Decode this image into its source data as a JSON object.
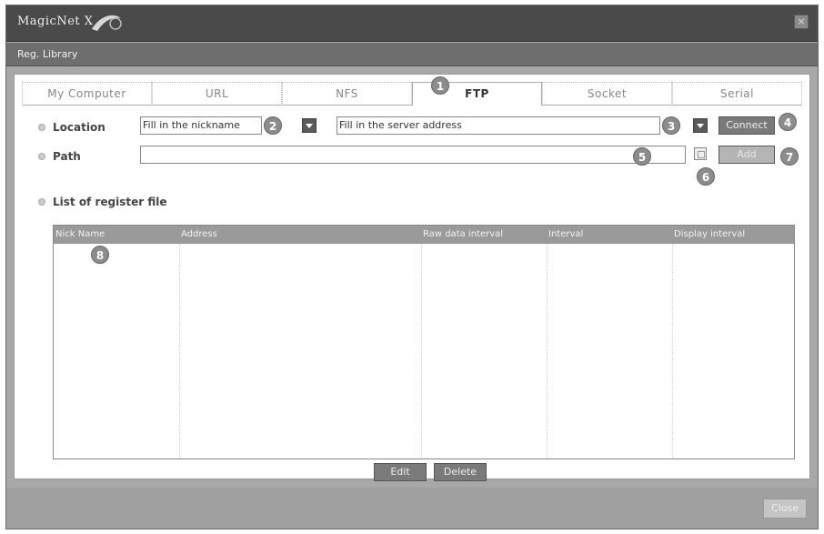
{
  "window": {
    "app_name": "MagicNet X",
    "close_glyph": "×"
  },
  "menubar": {
    "label": "Reg. Library"
  },
  "tabs": [
    {
      "label": "My Computer"
    },
    {
      "label": "URL"
    },
    {
      "label": "NFS"
    },
    {
      "label": "FTP",
      "active": true
    },
    {
      "label": "Socket"
    },
    {
      "label": "Serial"
    }
  ],
  "badges": [
    "1",
    "2",
    "3",
    "4",
    "5",
    "6",
    "7",
    "8"
  ],
  "location": {
    "label": "Location",
    "nickname_value": "Fill in the nickname",
    "server_value": "Fill in the server address",
    "connect_label": "Connect"
  },
  "path": {
    "label": "Path",
    "value": "",
    "add_label": "Add"
  },
  "register_list": {
    "label": "List of register file",
    "columns": [
      "Nick Name",
      "Address",
      "Raw data interval",
      "Interval",
      "Display interval"
    ]
  },
  "actions": {
    "edit_label": "Edit",
    "delete_label": "Delete"
  },
  "footer": {
    "close_label": "Close"
  }
}
